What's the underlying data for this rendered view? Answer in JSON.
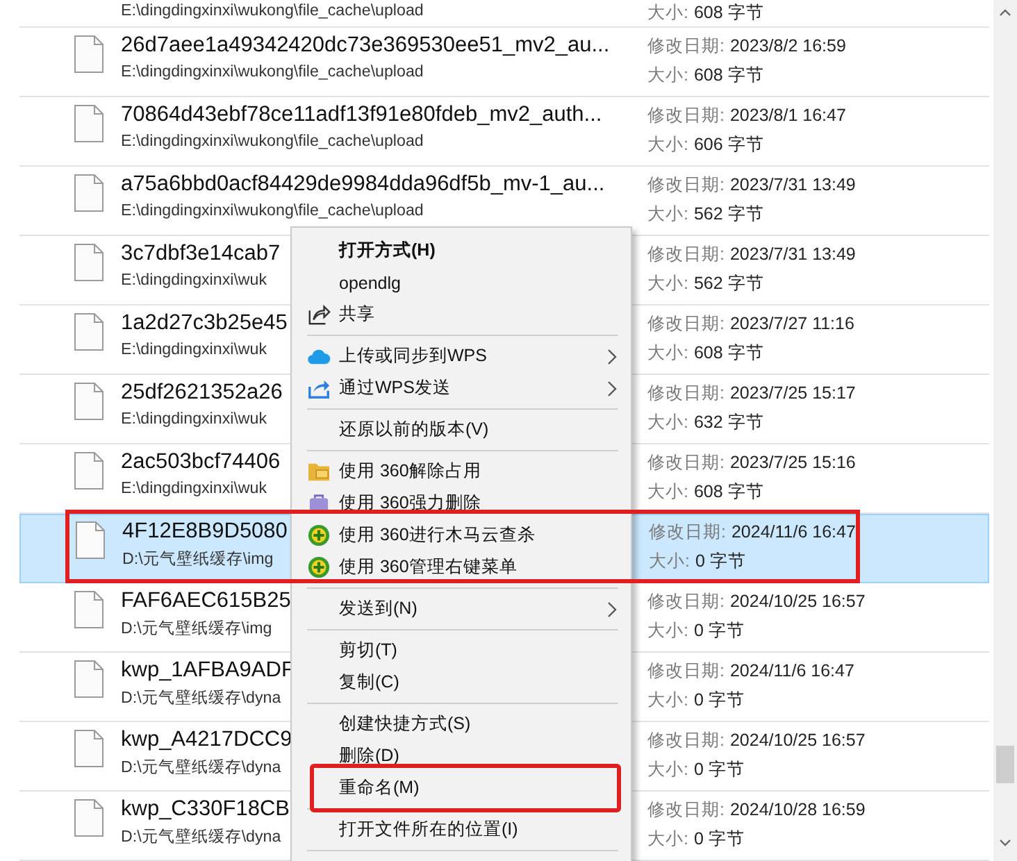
{
  "files": [
    {
      "path": "E:\\dingdingxinxi\\wukong\\file_cache\\upload",
      "size_label": "大小:",
      "size": "608 字节",
      "selected": false,
      "outlined": false
    },
    {
      "name": "26d7aee1a49342420dc73e369530ee51_mv2_au...",
      "path": "E:\\dingdingxinxi\\wukong\\file_cache\\upload",
      "date_label": "修改日期:",
      "date": "2023/8/2 16:59",
      "size_label": "大小:",
      "size": "608 字节",
      "selected": false,
      "outlined": false
    },
    {
      "name": "70864d43ebf78ce11adf13f91e80fdeb_mv2_auth...",
      "path": "E:\\dingdingxinxi\\wukong\\file_cache\\upload",
      "date_label": "修改日期:",
      "date": "2023/8/1 16:47",
      "size_label": "大小:",
      "size": "606 字节",
      "selected": false,
      "outlined": false
    },
    {
      "name": "a75a6bbd0acf84429de9984dda96df5b_mv-1_au...",
      "path": "E:\\dingdingxinxi\\wukong\\file_cache\\upload",
      "date_label": "修改日期:",
      "date": "2023/7/31 13:49",
      "size_label": "大小:",
      "size": "562 字节",
      "selected": false,
      "outlined": false
    },
    {
      "name": "3c7dbf3e14cab7",
      "path": "E:\\dingdingxinxi\\wuk",
      "date_label": "修改日期:",
      "date": "2023/7/31 13:49",
      "size_label": "大小:",
      "size": "562 字节",
      "selected": false,
      "outlined": false
    },
    {
      "name": "1a2d27c3b25e45",
      "path": "E:\\dingdingxinxi\\wuk",
      "date_label": "修改日期:",
      "date": "2023/7/27 11:16",
      "size_label": "大小:",
      "size": "608 字节",
      "selected": false,
      "outlined": false
    },
    {
      "name": "25df2621352a26",
      "path": "E:\\dingdingxinxi\\wuk",
      "date_label": "修改日期:",
      "date": "2023/7/25 15:17",
      "size_label": "大小:",
      "size": "632 字节",
      "selected": false,
      "outlined": false
    },
    {
      "name": "2ac503bcf74406",
      "path": "E:\\dingdingxinxi\\wuk",
      "date_label": "修改日期:",
      "date": "2023/7/25 15:16",
      "size_label": "大小:",
      "size": "608 字节",
      "selected": false,
      "outlined": false
    },
    {
      "name": "4F12E8B9D5080",
      "path": "D:\\元气壁纸缓存\\img",
      "date_label": "修改日期:",
      "date": "2024/11/6 16:47",
      "size_label": "大小:",
      "size": "0 字节",
      "selected": true,
      "outlined": true
    },
    {
      "name": "FAF6AEC615B25",
      "path": "D:\\元气壁纸缓存\\img",
      "date_label": "修改日期:",
      "date": "2024/10/25 16:57",
      "size_label": "大小:",
      "size": "0 字节",
      "selected": false,
      "outlined": false
    },
    {
      "name": "kwp_1AFBA9ADF",
      "path": "D:\\元气壁纸缓存\\dyna",
      "date_label": "修改日期:",
      "date": "2024/11/6 16:47",
      "size_label": "大小:",
      "size": "0 字节",
      "selected": false,
      "outlined": false
    },
    {
      "name": "kwp_A4217DCC9",
      "path": "D:\\元气壁纸缓存\\dyna",
      "date_label": "修改日期:",
      "date": "2024/10/25 16:57",
      "size_label": "大小:",
      "size": "0 字节",
      "selected": false,
      "outlined": false
    },
    {
      "name": "kwp_C330F18CB",
      "path": "D:\\元气壁纸缓存\\dyna",
      "date_label": "修改日期:",
      "date": "2024/10/28 16:59",
      "size_label": "大小:",
      "size": "0 字节",
      "selected": false,
      "outlined": false
    }
  ],
  "context_menu": [
    {
      "kind": "plain",
      "label": "打开方式(H)",
      "default": true,
      "submenu": false,
      "outlined": false
    },
    {
      "kind": "plain",
      "label": "opendlg",
      "default": false,
      "submenu": false,
      "outlined": false
    },
    {
      "kind": "share",
      "label": "共享",
      "default": false,
      "submenu": false,
      "outlined": false
    },
    {
      "kind": "separator"
    },
    {
      "kind": "cloud",
      "label": "上传或同步到WPS",
      "default": false,
      "submenu": true,
      "outlined": false
    },
    {
      "kind": "send",
      "label": "通过WPS发送",
      "default": false,
      "submenu": true,
      "outlined": false
    },
    {
      "kind": "separator"
    },
    {
      "kind": "plain",
      "label": "还原以前的版本(V)",
      "default": false,
      "submenu": false,
      "outlined": false
    },
    {
      "kind": "separator"
    },
    {
      "kind": "folder",
      "label": "使用 360解除占用",
      "default": false,
      "submenu": false,
      "outlined": false
    },
    {
      "kind": "bag",
      "label": "使用 360强力删除",
      "default": false,
      "submenu": false,
      "outlined": false
    },
    {
      "kind": "shield",
      "label": "使用 360进行木马云查杀",
      "default": false,
      "submenu": false,
      "outlined": false
    },
    {
      "kind": "shield",
      "label": "使用 360管理右键菜单",
      "default": false,
      "submenu": false,
      "outlined": false
    },
    {
      "kind": "separator"
    },
    {
      "kind": "plain",
      "label": "发送到(N)",
      "default": false,
      "submenu": true,
      "outlined": false
    },
    {
      "kind": "separator"
    },
    {
      "kind": "plain",
      "label": "剪切(T)",
      "default": false,
      "submenu": false,
      "outlined": false
    },
    {
      "kind": "plain",
      "label": "复制(C)",
      "default": false,
      "submenu": false,
      "outlined": false
    },
    {
      "kind": "separator"
    },
    {
      "kind": "plain",
      "label": "创建快捷方式(S)",
      "default": false,
      "submenu": false,
      "outlined": false
    },
    {
      "kind": "plain",
      "label": "删除(D)",
      "default": false,
      "submenu": false,
      "outlined": false
    },
    {
      "kind": "plain",
      "label": "重命名(M)",
      "default": false,
      "submenu": false,
      "outlined": true
    },
    {
      "kind": "separator"
    },
    {
      "kind": "plain",
      "label": "打开文件所在的位置(I)",
      "default": false,
      "submenu": false,
      "outlined": false
    },
    {
      "kind": "separator"
    }
  ]
}
